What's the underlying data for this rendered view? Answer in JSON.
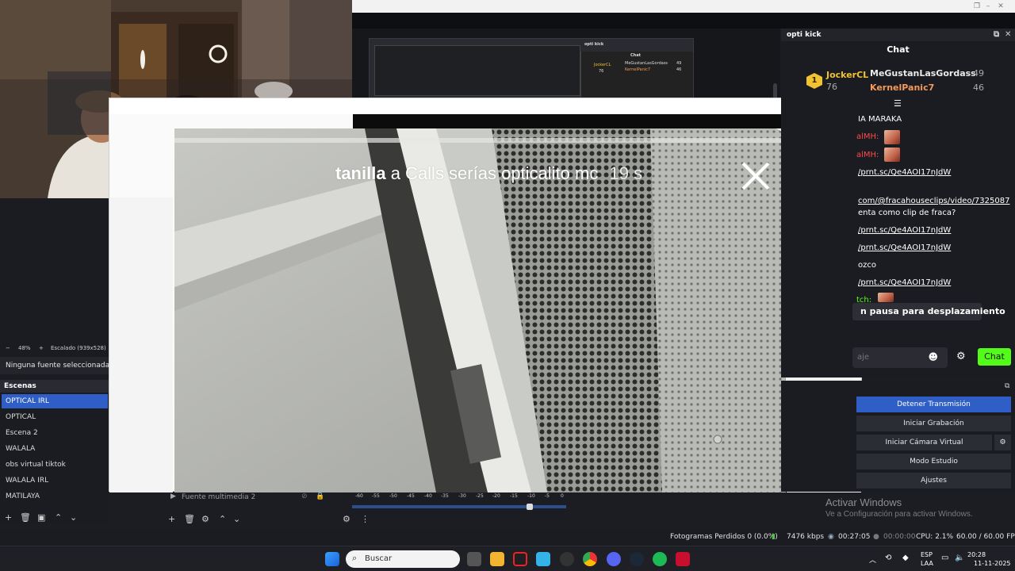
{
  "window": {
    "controls": [
      "–",
      "❐",
      "✕"
    ]
  },
  "popup": {
    "controls": [
      "—",
      "☐",
      "✕"
    ],
    "caption_user": "tanilla",
    "caption_text": "a Calls serías opticalito mc",
    "caption_time": "19 s"
  },
  "nested_preview": {
    "dock_title": "opti kick",
    "chat_title": "Chat",
    "user1": "JockerCL",
    "user2": "MeGustanLasGordass",
    "user3": "KernelPanic7",
    "val1": "76",
    "val2": "49",
    "val3": "46"
  },
  "chat_dock": {
    "title": "opti kick",
    "header": "Chat",
    "leaderboard": [
      {
        "rank": "1",
        "name": "JockerCL",
        "points": "76"
      },
      {
        "name": "MeGustanLasGordass",
        "points": "49"
      },
      {
        "name": "KernelPanic7",
        "points": "46"
      }
    ],
    "messages": [
      "IA MARAKA",
      "alMH:",
      "alMH:",
      "/prnt.sc/Qe4AOI17nJdW",
      "com/@fracahouseclips/video/7325087",
      "enta como clip de fraca?",
      "/prnt.sc/Qe4AOI17nJdW",
      "/prnt.sc/Qe4AOI17nJdW",
      "ozco",
      "/prnt.sc/Qe4AOI17nJdW",
      "tch:"
    ],
    "pause_tooltip": "n pausa para desplazamiento",
    "input_placeholder": "aje",
    "send_label": "Chat"
  },
  "left_panel": {
    "zoom": "48%",
    "scaled": "Escalado (939x528)",
    "no_source": "Ninguna fuente seleccionada",
    "scenes_header": "Escenas",
    "scenes": [
      "OPTICAL IRL",
      "OPTICAL",
      "Escena 2",
      "WALALA",
      "obs virtual tiktok",
      "WALALA IRL",
      "MATILAYA"
    ]
  },
  "sources": {
    "item": "Fuente multimedia 2"
  },
  "mixer": {
    "ticks": [
      "-60",
      "-55",
      "-50",
      "-45",
      "-40",
      "-35",
      "-30",
      "-25",
      "-20",
      "-15",
      "-10",
      "-5",
      "0"
    ]
  },
  "controls": {
    "stop_stream": "Detener Transmisión",
    "start_record": "Iniciar Grabación",
    "virtual_cam": "Iniciar Cámara Virtual",
    "studio_mode": "Modo Estudio",
    "settings": "Ajustes"
  },
  "activation": {
    "line1": "Activar Windows",
    "line2": "Ve a Configuración para activar Windows."
  },
  "status": {
    "dropped": "Fotogramas Perdidos 0 (0.0%)",
    "bitrate": "7476 kbps",
    "stream_time": "00:27:05",
    "rec_time": "00:00:00",
    "cpu": "CPU: 2.1%",
    "fps": "60.00 / 60.00 FPS"
  },
  "taskbar": {
    "search": "Buscar",
    "lang1": "ESP",
    "lang2": "LAA",
    "time": "20:28",
    "date": "11-11-2025"
  }
}
